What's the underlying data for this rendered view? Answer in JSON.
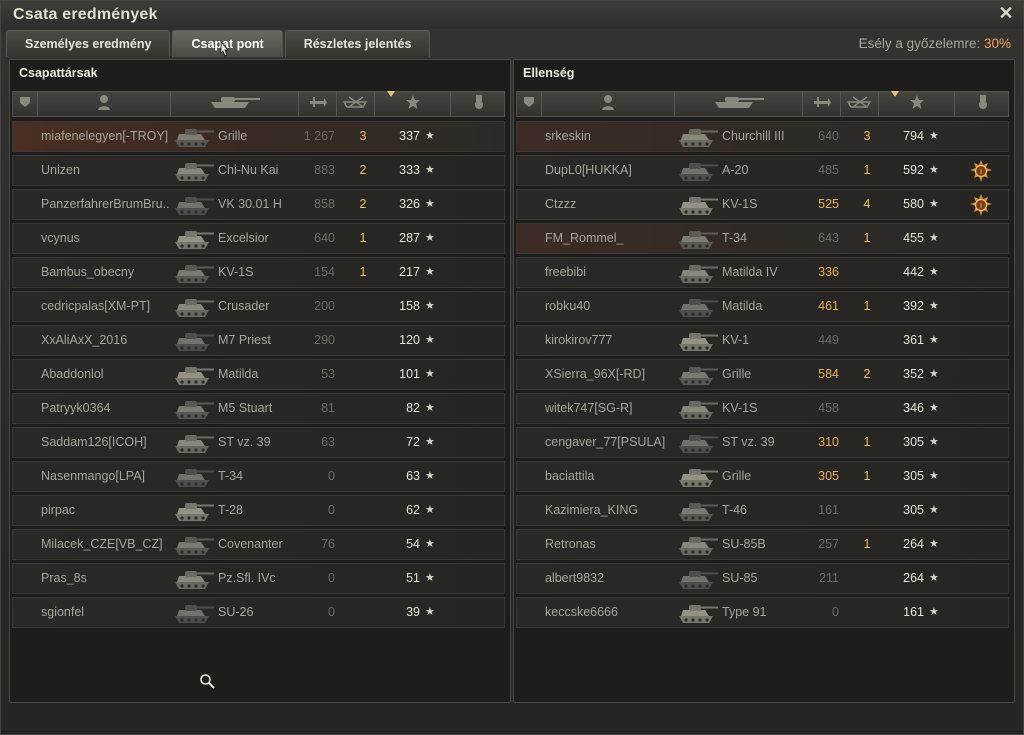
{
  "window": {
    "title": "Csata eredmények"
  },
  "tabs": [
    {
      "label": "Személyes eredmény",
      "active": false
    },
    {
      "label": "Csapat pont",
      "active": true
    },
    {
      "label": "Részletes jelentés",
      "active": false
    }
  ],
  "win_chance": {
    "label": "Esély a győzelemre: ",
    "value": "30%"
  },
  "colors": {
    "accent": "#f0a35a",
    "highlight_damage": "#e6b056",
    "frag": "#e6c36a"
  },
  "columns": {
    "platoon": "platoon-icon",
    "player": "player-icon",
    "tank": "tank-icon",
    "damage": "damage-icon",
    "frags": "kills-icon",
    "xp": "star-icon",
    "medal": "medal-icon"
  },
  "allies": {
    "title": "Csapattársak",
    "rows": [
      {
        "name": "miafenelegyen[-TROY]",
        "tank": "Grille",
        "damage": "1 267",
        "frags": "3",
        "xp": "337",
        "state": "me",
        "hot": false
      },
      {
        "name": "Unizen",
        "tank": "Chi-Nu Kai",
        "damage": "883",
        "frags": "2",
        "xp": "333",
        "state": "",
        "hot": false
      },
      {
        "name": "PanzerfahrerBrumBru..",
        "tank": "VK 30.01 H",
        "damage": "858",
        "frags": "2",
        "xp": "326",
        "state": "",
        "hot": false
      },
      {
        "name": "vcynus",
        "tank": "Excelsior",
        "damage": "640",
        "frags": "1",
        "xp": "287",
        "state": "",
        "hot": false
      },
      {
        "name": "Bambus_obecny",
        "tank": "KV-1S",
        "damage": "154",
        "frags": "1",
        "xp": "217",
        "state": "",
        "hot": false
      },
      {
        "name": "cedricpalas[XM-PT]",
        "tank": "Crusader",
        "damage": "200",
        "frags": "",
        "xp": "158",
        "state": "",
        "hot": false
      },
      {
        "name": "XxAliAxX_2016",
        "tank": "M7 Priest",
        "damage": "290",
        "frags": "",
        "xp": "120",
        "state": "",
        "hot": false
      },
      {
        "name": "Abaddonlol",
        "tank": "Matilda",
        "damage": "53",
        "frags": "",
        "xp": "101",
        "state": "",
        "hot": false
      },
      {
        "name": "Patryyk0364",
        "tank": "M5 Stuart",
        "damage": "81",
        "frags": "",
        "xp": "82",
        "state": "",
        "hot": false
      },
      {
        "name": "Saddam126[ICOH]",
        "tank": "ST vz. 39",
        "damage": "63",
        "frags": "",
        "xp": "72",
        "state": "",
        "hot": false
      },
      {
        "name": "Nasenmango[LPA]",
        "tank": "T-34",
        "damage": "0",
        "frags": "",
        "xp": "63",
        "state": "",
        "hot": false
      },
      {
        "name": "pirpac",
        "tank": "T-28",
        "damage": "0",
        "frags": "",
        "xp": "62",
        "state": "",
        "hot": false
      },
      {
        "name": "Milacek_CZE[VB_CZ]",
        "tank": "Covenanter",
        "damage": "76",
        "frags": "",
        "xp": "54",
        "state": "",
        "hot": false
      },
      {
        "name": "Pras_8s",
        "tank": "Pz.Sfl. IVc",
        "damage": "0",
        "frags": "",
        "xp": "51",
        "state": "",
        "hot": false
      },
      {
        "name": "sgionfel",
        "tank": "SU-26",
        "damage": "0",
        "frags": "",
        "xp": "39",
        "state": "",
        "hot": false
      }
    ]
  },
  "enemies": {
    "title": "Ellenség",
    "rows": [
      {
        "name": "srkeskin",
        "tank": "Churchill III",
        "damage": "640",
        "frags": "3",
        "xp": "794",
        "state": "hl",
        "hot": false,
        "medal": false
      },
      {
        "name": "DupL0[HUKKA]",
        "tank": "A-20",
        "damage": "485",
        "frags": "1",
        "xp": "592",
        "state": "",
        "hot": false,
        "medal": true
      },
      {
        "name": "Ctzzz",
        "tank": "KV-1S",
        "damage": "525",
        "frags": "4",
        "xp": "580",
        "state": "",
        "hot": true,
        "medal": true
      },
      {
        "name": "FM_Rommel_",
        "tank": "T-34",
        "damage": "643",
        "frags": "1",
        "xp": "455",
        "state": "hl",
        "hot": false,
        "medal": false
      },
      {
        "name": "freebibi",
        "tank": "Matilda IV",
        "damage": "336",
        "frags": "",
        "xp": "442",
        "state": "",
        "hot": true,
        "medal": false
      },
      {
        "name": "robku40",
        "tank": "Matilda",
        "damage": "461",
        "frags": "1",
        "xp": "392",
        "state": "",
        "hot": true,
        "medal": false
      },
      {
        "name": "kirokirov777",
        "tank": "KV-1",
        "damage": "449",
        "frags": "",
        "xp": "361",
        "state": "",
        "hot": false,
        "medal": false
      },
      {
        "name": "XSierra_96X[-RD]",
        "tank": "Grille",
        "damage": "584",
        "frags": "2",
        "xp": "352",
        "state": "",
        "hot": true,
        "medal": false
      },
      {
        "name": "witek747[SG-R]",
        "tank": "KV-1S",
        "damage": "458",
        "frags": "",
        "xp": "346",
        "state": "",
        "hot": false,
        "medal": false
      },
      {
        "name": "cengaver_77[PSULA]",
        "tank": "ST vz. 39",
        "damage": "310",
        "frags": "1",
        "xp": "305",
        "state": "",
        "hot": true,
        "medal": false
      },
      {
        "name": "baciattila",
        "tank": "Grille",
        "damage": "305",
        "frags": "1",
        "xp": "305",
        "state": "",
        "hot": true,
        "medal": false
      },
      {
        "name": "Kazimiera_KING",
        "tank": "T-46",
        "damage": "161",
        "frags": "",
        "xp": "305",
        "state": "",
        "hot": false,
        "medal": false
      },
      {
        "name": "Retronas",
        "tank": "SU-85B",
        "damage": "257",
        "frags": "1",
        "xp": "264",
        "state": "",
        "hot": false,
        "medal": false
      },
      {
        "name": "albert9832",
        "tank": "SU-85",
        "damage": "211",
        "frags": "",
        "xp": "264",
        "state": "",
        "hot": false,
        "medal": false
      },
      {
        "name": "keccske6666",
        "tank": "Type 91",
        "damage": "0",
        "frags": "",
        "xp": "161",
        "state": "",
        "hot": false,
        "medal": false
      }
    ]
  }
}
